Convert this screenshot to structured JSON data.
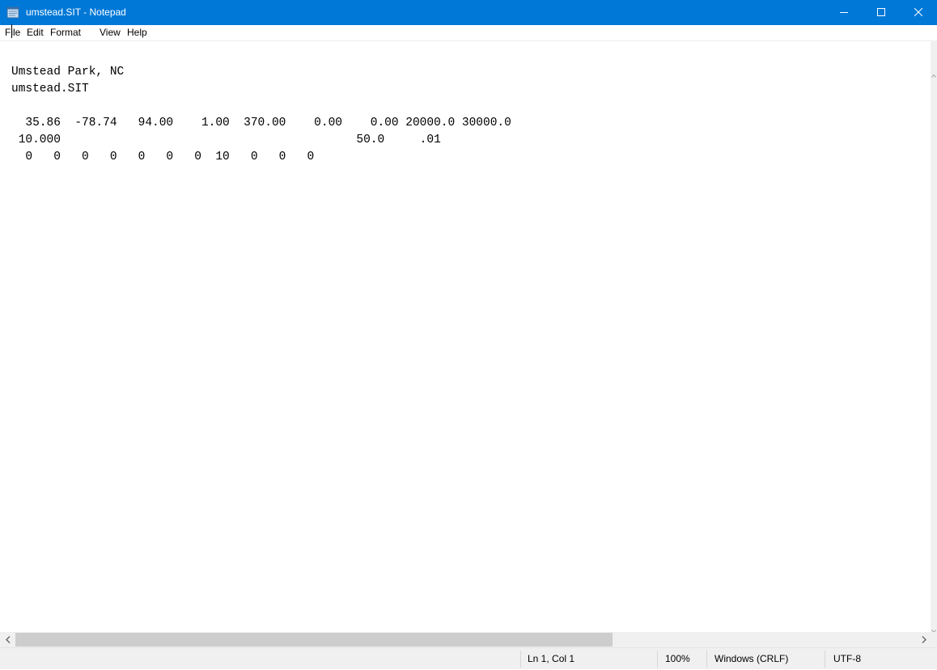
{
  "window": {
    "title": "umstead.SIT - Notepad",
    "accent_color": "#0078d7",
    "icon": "notepad-icon"
  },
  "menu": {
    "file": "File",
    "edit": "Edit",
    "format": "Format",
    "view": "View",
    "help": "Help"
  },
  "editor": {
    "lines": [
      "Umstead Park, NC",
      "umstead.SIT",
      "",
      "  35.86  -78.74   94.00    1.00  370.00    0.00    0.00 20000.0 30000.0",
      " 10.000                                          50.0     .01",
      "  0   0   0   0   0   0   0  10   0   0   0"
    ]
  },
  "statusbar": {
    "position": "Ln 1, Col 1",
    "zoom": "100%",
    "line_ending": "Windows (CRLF)",
    "encoding": "UTF-8"
  }
}
